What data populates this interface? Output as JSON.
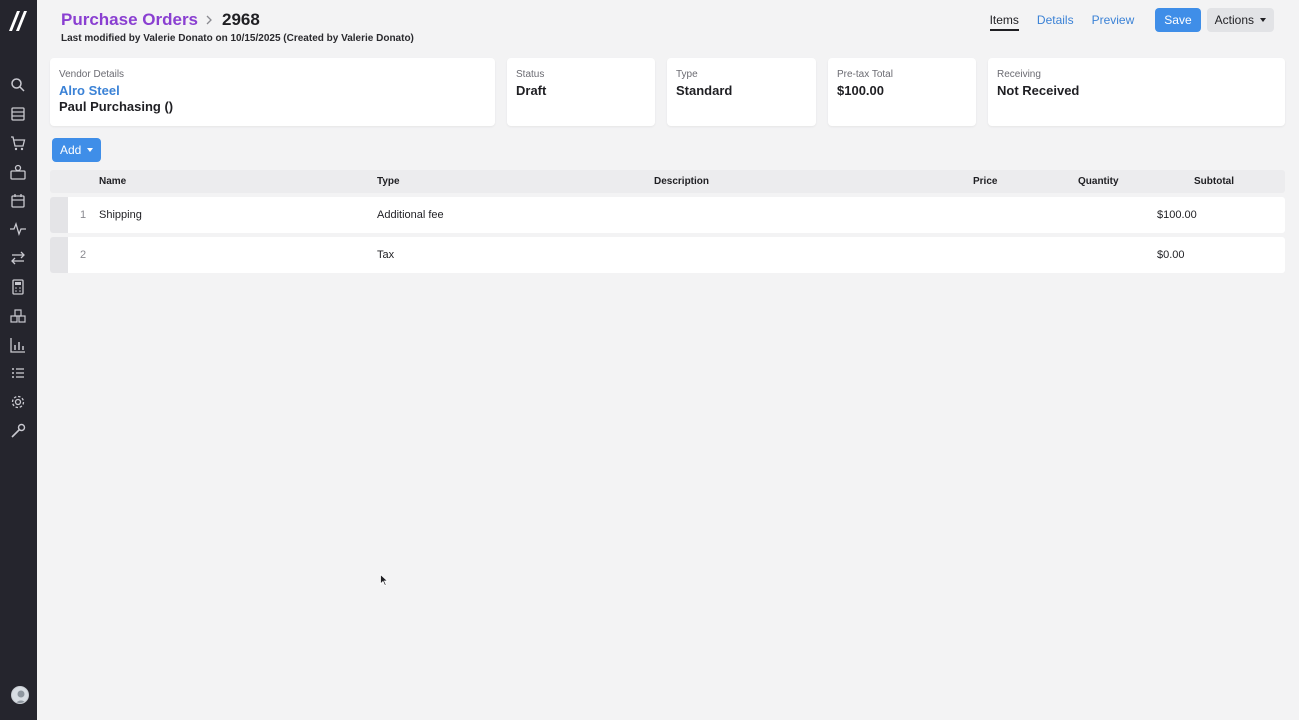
{
  "sidebar": {
    "icons": [
      "search-icon",
      "catalog-icon",
      "cart-icon",
      "contacts-icon",
      "calendar-icon",
      "activity-icon",
      "transfer-icon",
      "calculator-icon",
      "warehouse-icon",
      "analytics-icon",
      "list-icon",
      "settings-icon",
      "tools-icon"
    ]
  },
  "header": {
    "breadcrumb_parent": "Purchase Orders",
    "po_number": "2968",
    "modified_text": "Last modified by Valerie Donato on 10/15/2025 (Created by Valerie Donato)"
  },
  "tabs": [
    {
      "label": "Items",
      "active": true
    },
    {
      "label": "Details",
      "active": false
    },
    {
      "label": "Preview",
      "active": false
    }
  ],
  "toolbar": {
    "save_label": "Save",
    "actions_label": "Actions"
  },
  "cards": {
    "vendor": {
      "label": "Vendor Details",
      "name": "Alro Steel",
      "contact": "Paul Purchasing ()"
    },
    "status": {
      "label": "Status",
      "value": "Draft"
    },
    "type": {
      "label": "Type",
      "value": "Standard"
    },
    "pretax": {
      "label": "Pre-tax Total",
      "value": "$100.00"
    },
    "receiving": {
      "label": "Receiving",
      "value": "Not Received"
    }
  },
  "add_label": "Add",
  "table": {
    "columns": [
      "Name",
      "Type",
      "Description",
      "Price",
      "Quantity",
      "Subtotal"
    ],
    "rows": [
      {
        "num": "1",
        "name": "Shipping",
        "type": "Additional fee",
        "description": "",
        "price": "",
        "quantity": "",
        "subtotal": "$100.00"
      },
      {
        "num": "2",
        "name": "",
        "type": "Tax",
        "description": "",
        "price": "",
        "quantity": "",
        "subtotal": "$0.00"
      }
    ]
  },
  "colors": {
    "brand_purple": "#8a3fd1",
    "link_blue": "#3b82d6",
    "button_blue": "#3f8ee8",
    "sidebar_bg": "#25252d"
  }
}
